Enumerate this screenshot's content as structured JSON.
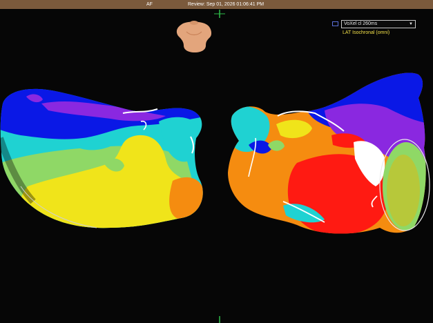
{
  "titlebar": {
    "left_label": "AF",
    "center_label": "Review: Sep 01, 2026 01:06:41 PM"
  },
  "map_selector": {
    "selected": "VoXel cl 260ms",
    "icon": "chevron-down-icon"
  },
  "map_type_label": "LAT Isochronal (omni)",
  "orientation_icon": "torso-orientation-icon",
  "colors": {
    "titlebar": "#7b5a3c",
    "label_yellow": "#f2e04a",
    "red": "#ff1a12",
    "orange": "#f58c10",
    "yellow": "#f0e41a",
    "green": "#8fd866",
    "cyan": "#1fd2d2",
    "blue": "#0a18e6",
    "purple": "#8a28e0"
  }
}
